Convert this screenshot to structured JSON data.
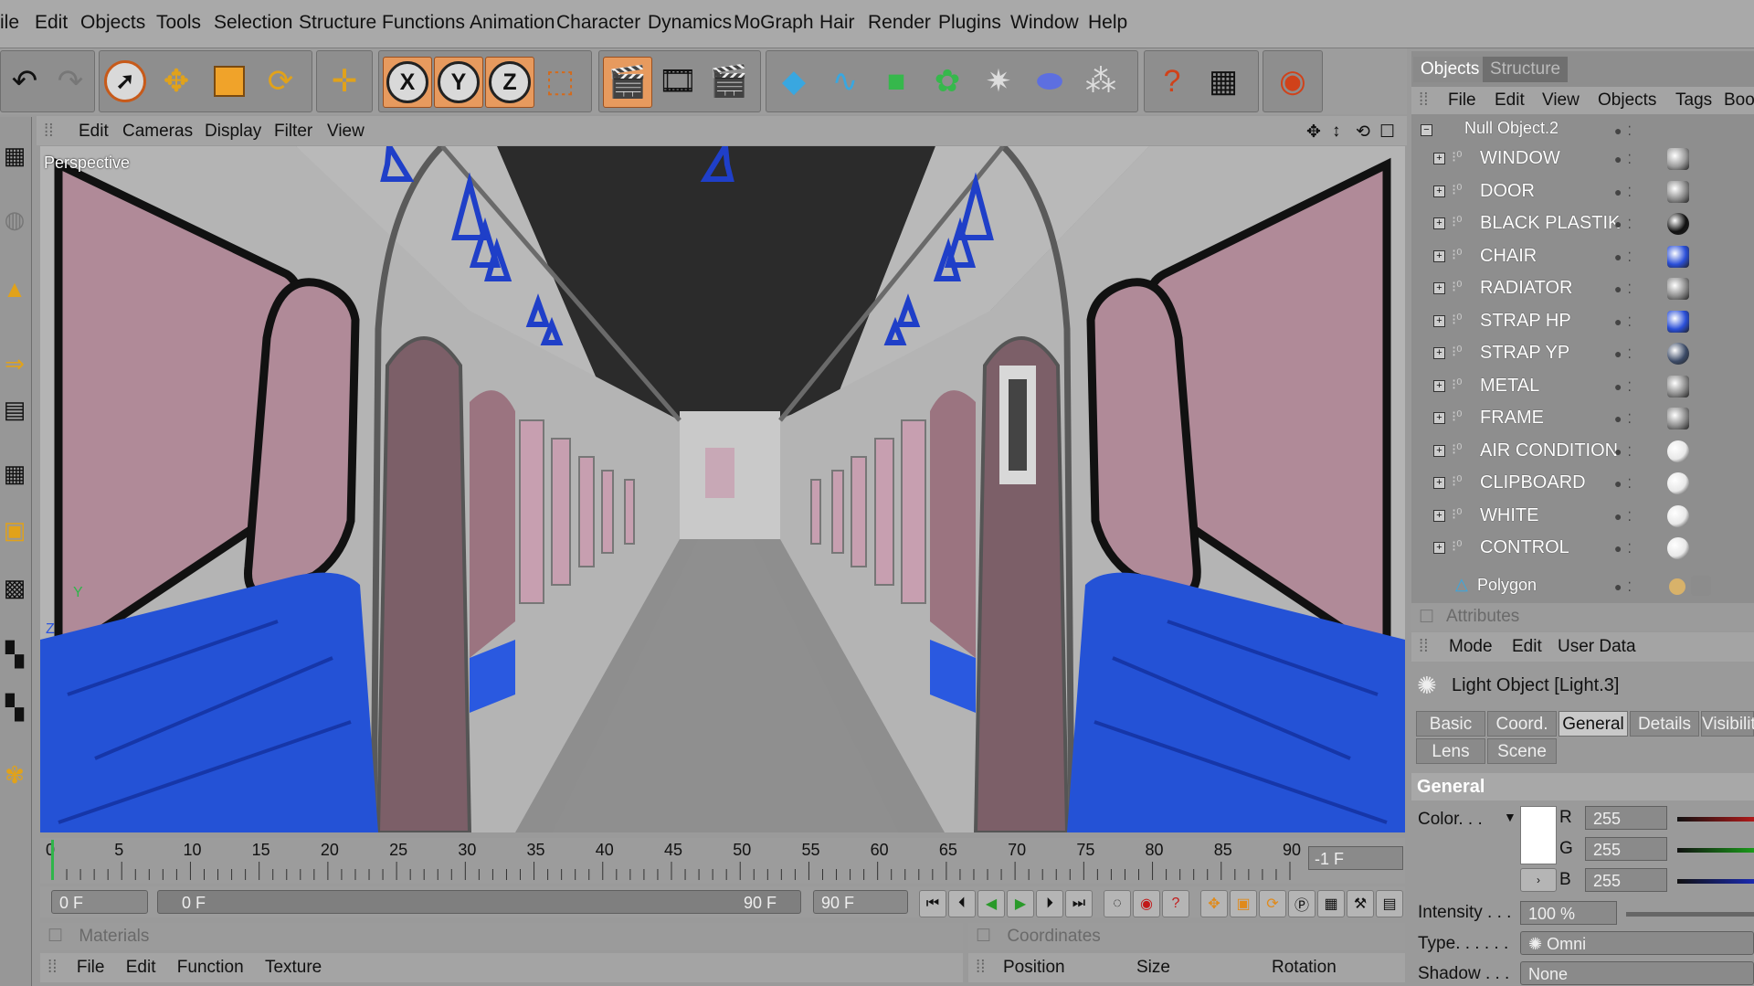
{
  "menubar": {
    "items": [
      "ile",
      "Edit",
      "Objects",
      "Tools",
      "Selection",
      "Structure",
      "Functions",
      "Animation",
      "Character",
      "Dynamics",
      "MoGraph",
      "Hair",
      "Render",
      "Plugins",
      "Window",
      "Help"
    ]
  },
  "toolbar": {
    "axis_x": "X",
    "axis_y": "Y",
    "axis_z": "Z"
  },
  "viewport": {
    "menu": [
      "Edit",
      "Cameras",
      "Display",
      "Filter",
      "View"
    ],
    "camera_label": "Perspective",
    "axis_y": "Y",
    "axis_z": "Z"
  },
  "timeline": {
    "ticks": [
      "0",
      "5",
      "10",
      "15",
      "20",
      "25",
      "30",
      "35",
      "40",
      "45",
      "50",
      "55",
      "60",
      "65",
      "70",
      "75",
      "80",
      "85",
      "90"
    ],
    "current_frame_field": "-1 F",
    "start_field": "0 F",
    "scrub_start": "0 F",
    "scrub_end": "90 F",
    "end_field": "90 F"
  },
  "materials": {
    "title": "Materials",
    "menu": [
      "File",
      "Edit",
      "Function",
      "Texture"
    ]
  },
  "coordinates": {
    "title": "Coordinates",
    "columns": [
      "Position",
      "Size",
      "Rotation"
    ]
  },
  "objects_panel": {
    "tab_objects": "Objects",
    "tab_structure": "Structure",
    "menu": [
      "File",
      "Edit",
      "View",
      "Objects",
      "Tags",
      "Book"
    ],
    "top_item": "Null Object.2",
    "items": [
      {
        "label": "WINDOW",
        "mat_color": "#9a9a9a"
      },
      {
        "label": "DOOR",
        "mat_color": "#8c8c8c"
      },
      {
        "label": "BLACK PLASTIK",
        "mat_color": "#111111"
      },
      {
        "label": "CHAIR",
        "mat_color": "#2a4fd8"
      },
      {
        "label": "RADIATOR",
        "mat_color": "#8c8c8c"
      },
      {
        "label": "STRAP HP",
        "mat_color": "#2a4fd8"
      },
      {
        "label": "STRAP YP",
        "mat_color": "#3b4a66"
      },
      {
        "label": "METAL",
        "mat_color": "#8c8c8c"
      },
      {
        "label": "FRAME",
        "mat_color": "#8c8c8c"
      },
      {
        "label": "AIR CONDITION",
        "mat_color": "#e8e8e8"
      },
      {
        "label": "CLIPBOARD",
        "mat_color": "#e8e8e8"
      },
      {
        "label": "WHITE",
        "mat_color": "#e8e8e8"
      },
      {
        "label": "CONTROL",
        "mat_color": "#e8e8e8"
      }
    ],
    "polygon_label": "Polygon"
  },
  "attributes": {
    "title": "Attributes",
    "menu": [
      "Mode",
      "Edit",
      "User Data"
    ],
    "object_title": "Light Object [Light.3]",
    "tabs_row1": [
      "Basic",
      "Coord.",
      "General",
      "Details",
      "Visibility"
    ],
    "tabs_row2": [
      "Lens",
      "Scene"
    ],
    "active_tab": "General",
    "section": "General",
    "color_label": "Color. . .",
    "r_label": "R",
    "r_value": "255",
    "g_label": "G",
    "g_value": "255",
    "b_label": "B",
    "b_value": "255",
    "intensity_label": "Intensity . . .",
    "intensity_value": "100 %",
    "type_label": "Type. . . . . .",
    "type_value": "Omni",
    "shadow_label": "Shadow . . .",
    "shadow_value": "None"
  },
  "colors": {
    "seat_blue": "#2452d6",
    "window_pink": "#b08a98",
    "strap_blue": "#1f3fc8",
    "active_orange": "#e79a5e"
  }
}
